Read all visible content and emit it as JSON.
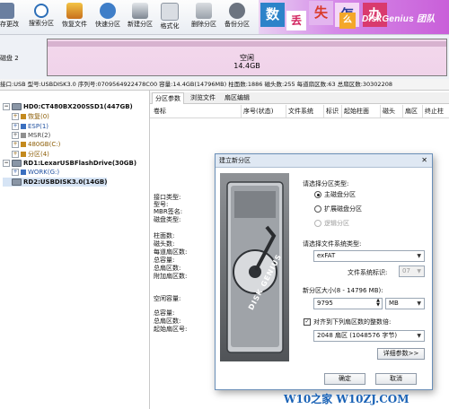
{
  "toolbar": {
    "buttons": [
      {
        "label": "保存更改",
        "icon": "save-icon"
      },
      {
        "label": "搜索分区",
        "icon": "search-icon"
      },
      {
        "label": "恢复文件",
        "icon": "recover-file-icon"
      },
      {
        "label": "快速分区",
        "icon": "quick-partition-icon"
      },
      {
        "label": "新建分区",
        "icon": "new-partition-icon"
      },
      {
        "label": "格式化",
        "icon": "format-icon"
      },
      {
        "label": "删除分区",
        "icon": "delete-icon"
      },
      {
        "label": "备份分区",
        "icon": "backup-icon"
      }
    ]
  },
  "banner": {
    "chars": [
      "数",
      "丢",
      "失",
      "怎",
      "么",
      "办"
    ],
    "brand": "DiskGenius 团队"
  },
  "disk_map": {
    "disk_label": "磁盘 2",
    "space_label": "空闲",
    "space_size": "14.4GB"
  },
  "info_bar": {
    "text": "接口:USB  型号:USBDISK3.0  序列号:0709564922478C00  容量:14.4GB(14796MB)  柱面数:1886  磁头数:255  每道扇区数:63  总扇区数:30302208"
  },
  "tree": {
    "nodes": [
      {
        "label": "HD0:CT480BX200SSD1(447GB)",
        "kind": "disk",
        "level": 0
      },
      {
        "label": "恢复(0)",
        "kind": "partition",
        "level": 1
      },
      {
        "label": "ESP(1)",
        "kind": "partition",
        "level": 1
      },
      {
        "label": "MSR(2)",
        "kind": "partition",
        "level": 1
      },
      {
        "label": "480GB(C:)",
        "kind": "partition",
        "level": 1
      },
      {
        "label": "分区(4)",
        "kind": "partition",
        "level": 1
      },
      {
        "label": "RD1:LexarUSBFlashDrive(30GB)",
        "kind": "disk",
        "level": 0
      },
      {
        "label": "WORK(G:)",
        "kind": "partition",
        "level": 1
      },
      {
        "label": "RD2:USBDISK3.0(14GB)",
        "kind": "disk",
        "level": 0
      }
    ]
  },
  "right_panel": {
    "tabs": [
      "分区参数",
      "浏览文件",
      "扇区编辑"
    ],
    "columns": [
      "卷标",
      "序号(状态)",
      "文件系统",
      "标识",
      "起始柱面",
      "磁头",
      "扇区",
      "终止柱"
    ],
    "detail_labels_1": [
      "接口类型:",
      "型号:",
      "MBR签名:",
      "磁盘类型:"
    ],
    "detail_labels_2": [
      "柱面数:",
      "磁头数:",
      "每道扇区数:",
      "总容量:",
      "总扇区数:",
      "附加扇区数:"
    ],
    "detail_labels_3": [
      "空闲容量:",
      "总容量:",
      "总扇区数:",
      "起始扇区号:"
    ]
  },
  "dialog": {
    "title": "建立新分区",
    "partition_type_label": "请选择分区类型:",
    "radio_primary": "主磁盘分区",
    "radio_extended": "扩展磁盘分区",
    "radio_logical": "逻辑分区",
    "fs_label": "请选择文件系统类型:",
    "fs_value": "exFAT",
    "fs_id_label": "文件系统标识:",
    "fs_id_value": "07",
    "size_label": "新分区大小(8 - 14796 MB):",
    "size_value": "9795",
    "size_unit": "MB",
    "align_label": "对齐到下列扇区数的整数倍:",
    "align_value": "2048 扇区 (1048576 字节)",
    "detail_button": "详细参数>>",
    "ok_button": "确定",
    "cancel_button": "取消",
    "image_text": "DISK GENIUS"
  },
  "watermark": "W10之家 W10ZJ.COM",
  "colors": {
    "banner": "#c95fd9",
    "disk_free": "#f3d8ec",
    "watermark": "#1b63b6"
  }
}
